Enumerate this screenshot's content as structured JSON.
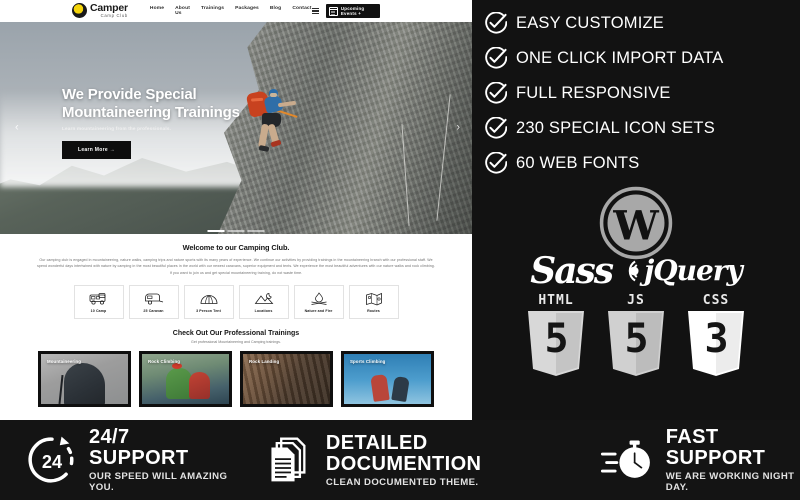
{
  "site": {
    "header": {
      "logo_name": "Camper",
      "logo_sub": "Camp Club",
      "nav": [
        {
          "label": "Home"
        },
        {
          "label": "About Us"
        },
        {
          "label": "Trainings"
        },
        {
          "label": "Packages"
        },
        {
          "label": "Blog"
        },
        {
          "label": "Contact"
        }
      ],
      "events_button": "Upcoming Events +"
    },
    "hero": {
      "title_line1": "We Provide Special",
      "title_line2": "Mountaineering Trainings",
      "subtitle": "Learn mountaineering from the professionals.",
      "button": "Learn More →",
      "prev_arrow": "‹",
      "next_arrow": "›"
    },
    "welcome": {
      "heading": "Welcome to our Camping Club.",
      "body": "Our camping club is engaged in mountaineering, nature walks, camping trips and nature sports with its many years of experience. We continue our activities by providing trainings in the mountaineering branch with our professional staff. We spend wonderful days intertwined with nature by camping in the most beautiful places in the world with our newest caravans, superior equipment and tents. We experience the most beautiful adventures with our nature walks and rock climbing. If you want to join us and get special mountaineering training, do not waste time."
    },
    "features": [
      {
        "label": "10 Camp",
        "icon": "rv-camper-icon"
      },
      {
        "label": "25 Caravan",
        "icon": "caravan-trailer-icon"
      },
      {
        "label": "3 Person Tent",
        "icon": "tent-icon"
      },
      {
        "label": "Locations",
        "icon": "mountain-moon-icon"
      },
      {
        "label": "Nature and Fire",
        "icon": "campfire-icon"
      },
      {
        "label": "Routes",
        "icon": "map-routes-icon"
      }
    ],
    "trainings": {
      "heading": "Check Out Our Professional Trainings",
      "subheading": "Get professional Mountaineering and Camping trainings.",
      "cards": [
        {
          "label": "Mountaineering"
        },
        {
          "label": "Rock Climbing"
        },
        {
          "label": "Rock Landing"
        },
        {
          "label": "Sports Climbing"
        }
      ]
    }
  },
  "panel": {
    "features": [
      {
        "label": "EASY CUSTOMIZE"
      },
      {
        "label": "ONE CLICK IMPORT DATA"
      },
      {
        "label": "FULL RESPONSIVE"
      },
      {
        "label": "230 SPECIAL ICON SETS"
      },
      {
        "label": "60 WEB FONTS"
      }
    ],
    "logos": {
      "wordpress": "wordpress-logo",
      "sass": "Sass",
      "jquery": "jQuery",
      "badges": [
        {
          "name": "HTML",
          "number": "5"
        },
        {
          "name": "JS",
          "number": "5"
        },
        {
          "name": "CSS",
          "number": "3"
        }
      ]
    }
  },
  "bottom": [
    {
      "title": "24/7 SUPPORT",
      "subtitle": "OUR SPEED WILL AMAZING YOU.",
      "icon": "24-clock-arrow-icon",
      "badge_number": "24"
    },
    {
      "title": "DETAILED DOCUMENTION",
      "subtitle": "CLEAN DOCUMENTED THEME.",
      "icon": "documents-stack-icon"
    },
    {
      "title": "FAST SUPPORT",
      "subtitle": "WE ARE WORKING NIGHT DAY.",
      "icon": "stopwatch-speed-icon"
    }
  ],
  "colors": {
    "panel_bg": "#121212",
    "bottom_bg": "#141414",
    "accent_dark": "#0d0d0d",
    "logo_yellow": "#f5d50a"
  }
}
